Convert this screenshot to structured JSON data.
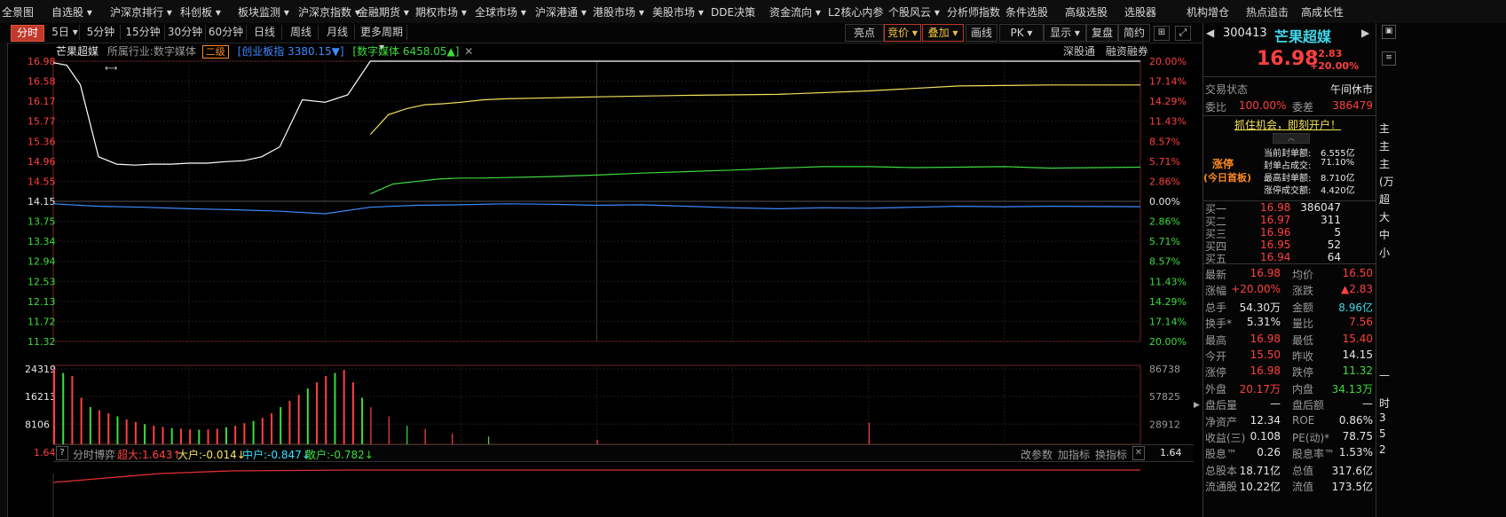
{
  "top_menu": {
    "left_label": "全景图",
    "items": [
      "自选股 ▾",
      "沪深京排行 ▾",
      "科创板 ▾",
      "板块监测 ▾",
      "沪深京指数 ▾",
      "金融期货 ▾",
      "期权市场 ▾",
      "全球市场 ▾",
      "沪深港通 ▾",
      "港股市场 ▾",
      "美股市场 ▾",
      "DDE决策",
      "资金流向 ▾",
      "L2核心内参",
      "个股风云 ▾",
      "分析师指数",
      "条件选股",
      "高级选股",
      "选股器",
      "机构增仓",
      "热点追击",
      "高成长性"
    ]
  },
  "periods": [
    "分时",
    "5日 ▾",
    "5分钟",
    "15分钟",
    "30分钟",
    "60分钟",
    "日线",
    "周线",
    "月线",
    "更多周期 ▾"
  ],
  "right_tools": [
    "亮点",
    "竞价 ▾",
    "叠加 ▾",
    "画线",
    "PK ▾",
    "显示 ▾",
    "复盘",
    "简约"
  ],
  "chart_header": {
    "name": "芒果超媒",
    "industry_label": "所属行业:",
    "industry": "数字媒体",
    "level_badge": "二级",
    "index1": "[创业板指 3380.15▼]",
    "index2": "[数字媒体 6458.05▲]",
    "close_mark": "✕",
    "links": [
      "深股通",
      "融资融券"
    ]
  },
  "chart_data": {
    "type": "line",
    "y_price_ticks": [
      "16.98",
      "16.58",
      "16.17",
      "15.77",
      "15.36",
      "14.96",
      "14.55",
      "14.15",
      "13.75",
      "13.34",
      "12.94",
      "12.53",
      "12.13",
      "11.72",
      "11.32"
    ],
    "y_pct_ticks": [
      "20.00%",
      "17.14%",
      "14.29%",
      "11.43%",
      "8.57%",
      "5.71%",
      "2.86%",
      "0.00%",
      "2.86%",
      "5.71%",
      "8.57%",
      "11.43%",
      "14.29%",
      "17.14%",
      "20.00%"
    ],
    "ylim": [
      11.32,
      16.98
    ],
    "prev_close": 14.15,
    "series": [
      {
        "name": "price",
        "color": "#ffffff",
        "x": [
          0,
          3,
          6,
          10,
          14,
          18,
          22,
          26,
          30,
          34,
          38,
          42,
          46,
          50,
          55,
          60,
          65,
          70,
          75,
          80,
          85,
          90,
          95,
          100,
          110,
          120,
          130,
          140,
          150,
          180,
          240
        ],
        "y": [
          16.95,
          16.9,
          16.5,
          15.05,
          14.9,
          14.88,
          14.9,
          14.9,
          14.92,
          14.92,
          14.95,
          14.97,
          15.05,
          15.25,
          16.2,
          16.15,
          16.3,
          16.98,
          16.98,
          16.98,
          16.98,
          16.98,
          16.98,
          16.98,
          16.98,
          16.98,
          16.98,
          16.98,
          16.98,
          16.98,
          16.98
        ]
      },
      {
        "name": "avg",
        "color": "#f3e15b",
        "x": [
          70,
          74,
          78,
          82,
          86,
          90,
          95,
          100,
          110,
          120,
          140,
          160,
          180,
          200,
          220,
          240
        ],
        "y": [
          15.5,
          15.9,
          16.02,
          16.1,
          16.12,
          16.15,
          16.2,
          16.22,
          16.24,
          16.26,
          16.29,
          16.31,
          16.38,
          16.48,
          16.5,
          16.5
        ]
      },
      {
        "name": "数字媒体",
        "color": "#3ddc3d",
        "x": [
          70,
          75,
          80,
          85,
          90,
          95,
          100,
          110,
          120,
          130,
          140,
          150,
          160,
          170,
          180,
          190,
          200,
          210,
          220,
          240
        ],
        "y": [
          14.3,
          14.5,
          14.55,
          14.6,
          14.62,
          14.62,
          14.63,
          14.65,
          14.68,
          14.72,
          14.75,
          14.78,
          14.82,
          14.85,
          14.85,
          14.83,
          14.84,
          14.85,
          14.82,
          14.84
        ]
      },
      {
        "name": "创业板指",
        "color": "#3d8bff",
        "x": [
          0,
          10,
          20,
          30,
          40,
          50,
          60,
          70,
          80,
          90,
          100,
          110,
          120,
          130,
          140,
          150,
          160,
          170,
          180,
          190,
          200,
          210,
          220,
          240
        ],
        "y": [
          14.1,
          14.05,
          14.03,
          14,
          13.98,
          13.95,
          13.9,
          14.03,
          14.07,
          14.08,
          14.1,
          14.09,
          14.07,
          14.08,
          14.05,
          14.02,
          14,
          14.02,
          14.01,
          14.03,
          14.05,
          14.04,
          14.05,
          14.04
        ]
      }
    ],
    "volume_ticks_left": [
      "24319",
      "16213",
      "8106"
    ],
    "volume_ticks_right": [
      "86738",
      "57825",
      "28912"
    ],
    "volume": {
      "x": [
        0,
        2,
        4,
        6,
        8,
        10,
        12,
        14,
        16,
        18,
        20,
        22,
        24,
        26,
        28,
        30,
        32,
        34,
        36,
        38,
        40,
        42,
        44,
        46,
        48,
        50,
        52,
        54,
        56,
        58,
        60,
        62,
        64,
        66,
        68,
        70,
        74,
        78,
        82,
        88,
        96,
        120,
        180
      ],
      "v": [
        24319,
        23000,
        22000,
        15000,
        12000,
        11000,
        10000,
        9000,
        8000,
        7200,
        6500,
        6000,
        5600,
        5200,
        5000,
        4800,
        4700,
        4800,
        5000,
        5500,
        6000,
        6800,
        7500,
        8500,
        10000,
        12000,
        14000,
        16000,
        18000,
        20000,
        22000,
        23000,
        24000,
        20000,
        15000,
        12000,
        9000,
        6000,
        5000,
        3500,
        2500,
        1500,
        7000
      ]
    }
  },
  "indicator_bar": {
    "question": "?",
    "name": "分时博弈",
    "super": "超大:1.643↑",
    "large": "大户:-0.014↓",
    "mid": "中户:-0.847↓",
    "small": "散户:-0.782↓",
    "actions": [
      "改参数",
      "加指标",
      "换指标"
    ],
    "left_value": "1.64",
    "right_value": "1.64"
  },
  "quote": {
    "code": "300413",
    "name": "芒果超媒",
    "price": "16.98",
    "change": "+2.83",
    "change_pct": "+20.00%",
    "status_label": "交易状态",
    "status": "午间休市",
    "webi_label": "委比",
    "webi": "100.00%",
    "weicha_label": "委差",
    "weicha": "386479",
    "banner": "抓住机会，即刻开户！",
    "limit_title": "涨停",
    "limit_sub": "(今日首板)",
    "limit_stats": [
      {
        "label": "当前封单额:",
        "value": "6.555亿"
      },
      {
        "label": "封单占成交:",
        "value": "71.10%"
      },
      {
        "label": "最高封单额:",
        "value": "8.710亿"
      },
      {
        "label": "涨停成交额:",
        "value": "4.420亿"
      }
    ],
    "bids": [
      {
        "label": "买一",
        "price": "16.98",
        "vol": "386047"
      },
      {
        "label": "买二",
        "price": "16.97",
        "vol": "311"
      },
      {
        "label": "买三",
        "price": "16.96",
        "vol": "5"
      },
      {
        "label": "买四",
        "price": "16.95",
        "vol": "52"
      },
      {
        "label": "买五",
        "price": "16.94",
        "vol": "64"
      }
    ],
    "stats": [
      [
        "最新",
        "16.98",
        "red",
        "均价",
        "16.50",
        "red"
      ],
      [
        "涨幅",
        "+20.00%",
        "red",
        "涨跌",
        "▲2.83",
        "red"
      ],
      [
        "总手",
        "54.30万",
        "white",
        "金额",
        "8.96亿",
        "cyan"
      ],
      [
        "换手*",
        "5.31%",
        "white",
        "量比",
        "7.56",
        "red"
      ],
      [
        "最高",
        "16.98",
        "red",
        "最低",
        "15.40",
        "red"
      ],
      [
        "今开",
        "15.50",
        "red",
        "昨收",
        "14.15",
        "white"
      ],
      [
        "涨停",
        "16.98",
        "red",
        "跌停",
        "11.32",
        "green"
      ],
      [
        "外盘",
        "20.17万",
        "red",
        "内盘",
        "34.13万",
        "green"
      ],
      [
        "盘后量",
        "—",
        "white",
        "盘后额",
        "—",
        "white"
      ],
      [
        "净资产",
        "12.34",
        "white",
        "ROE",
        "0.86%",
        "white"
      ],
      [
        "收益(三)",
        "0.108",
        "white",
        "PE(动)*",
        "78.75",
        "white"
      ],
      [
        "股息™",
        "0.26",
        "white",
        "股息率™",
        "1.53%",
        "white"
      ],
      [
        "总股本",
        "18.71亿",
        "white",
        "总值",
        "317.6亿",
        "white"
      ],
      [
        "流通股",
        "10.22亿",
        "white",
        "流值",
        "173.5亿",
        "white"
      ]
    ]
  },
  "far_right": {
    "labels": [
      "主",
      "主",
      "主",
      "(万",
      "超",
      "大",
      "中",
      "小",
      "—",
      "时",
      "3",
      "5",
      "2"
    ]
  }
}
